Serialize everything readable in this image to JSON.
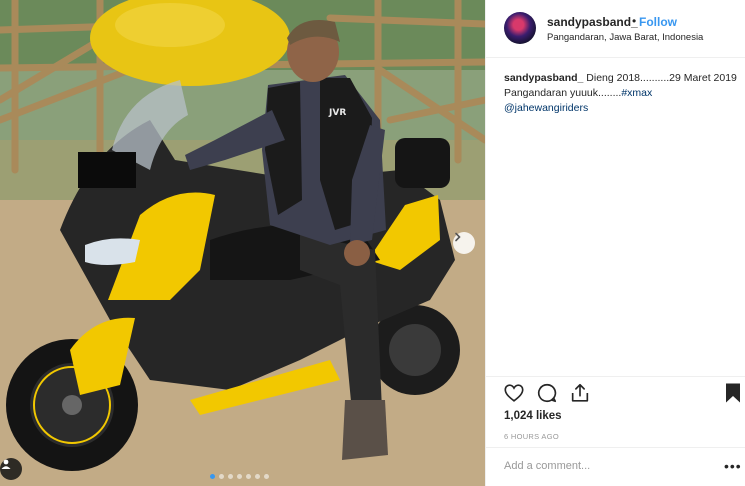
{
  "post": {
    "username": "sandypasband_",
    "separator": "•",
    "follow_label": "Follow",
    "location": "Pangandaran, Jawa Barat, Indonesia",
    "caption": {
      "user": "sandypasband_",
      "text": "Dieng 2018..........29 Maret 2019 Pangandaran yuuuk........",
      "hashtag": "#xmax",
      "mention": "@jahewangiriders"
    },
    "likes": "1,024 likes",
    "time": "6 HOURS AGO",
    "comment_placeholder": "Add a comment...",
    "more_label": "•••"
  },
  "carousel": {
    "total": 7,
    "active_index": 0
  },
  "icons": [
    "heart-icon",
    "comment-icon",
    "share-icon",
    "bookmark-icon",
    "chevron-right-icon",
    "user-tag-icon"
  ],
  "colors": {
    "link": "#3897f0",
    "hashtag": "#003569",
    "scooter_accent": "#f2c800",
    "muted": "#999999"
  }
}
